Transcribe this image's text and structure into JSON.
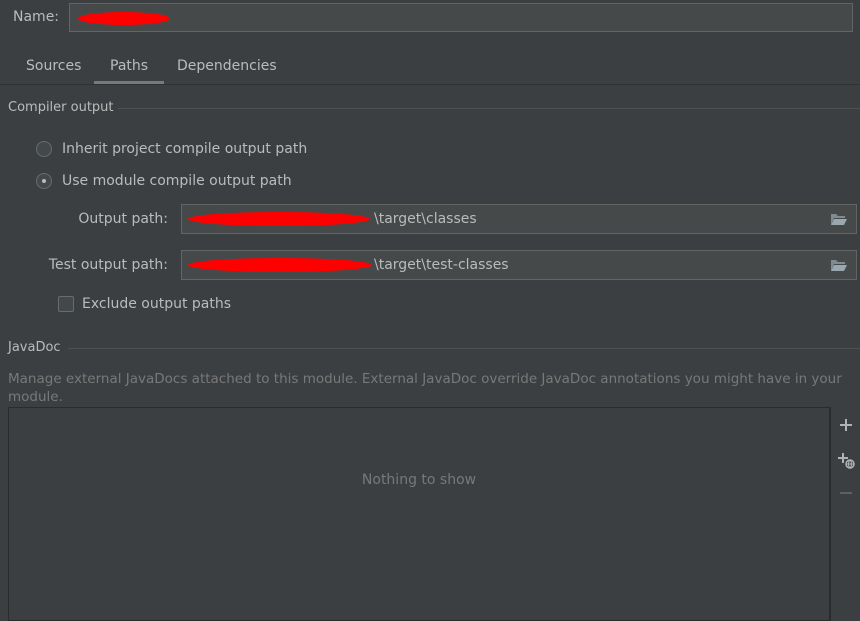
{
  "name_row": {
    "label": "Name:",
    "value": ""
  },
  "tabs": [
    {
      "label": "Sources",
      "active": false
    },
    {
      "label": "Paths",
      "active": true
    },
    {
      "label": "Dependencies",
      "active": false
    }
  ],
  "compiler_output": {
    "title": "Compiler output",
    "options": [
      {
        "label": "Inherit project compile output path",
        "selected": false
      },
      {
        "label": "Use module compile output path",
        "selected": true
      }
    ],
    "output_path": {
      "label": "Output path:",
      "value_suffix": "\\target\\classes"
    },
    "test_output_path": {
      "label": "Test output path:",
      "value_suffix": "\\target\\test-classes"
    },
    "exclude": {
      "label": "Exclude output paths",
      "checked": false
    }
  },
  "javadoc": {
    "title": "JavaDoc",
    "description": "Manage external JavaDocs attached to this module. External JavaDoc override JavaDoc annotations you might have in your module.",
    "empty_text": "Nothing to show",
    "toolbar": [
      "add-icon",
      "add-url-icon",
      "remove-icon"
    ]
  },
  "colors": {
    "background": "#3c3f41",
    "field": "#45494a",
    "text": "#bbbbbb",
    "muted": "#787878",
    "redaction": "#ff0000"
  }
}
